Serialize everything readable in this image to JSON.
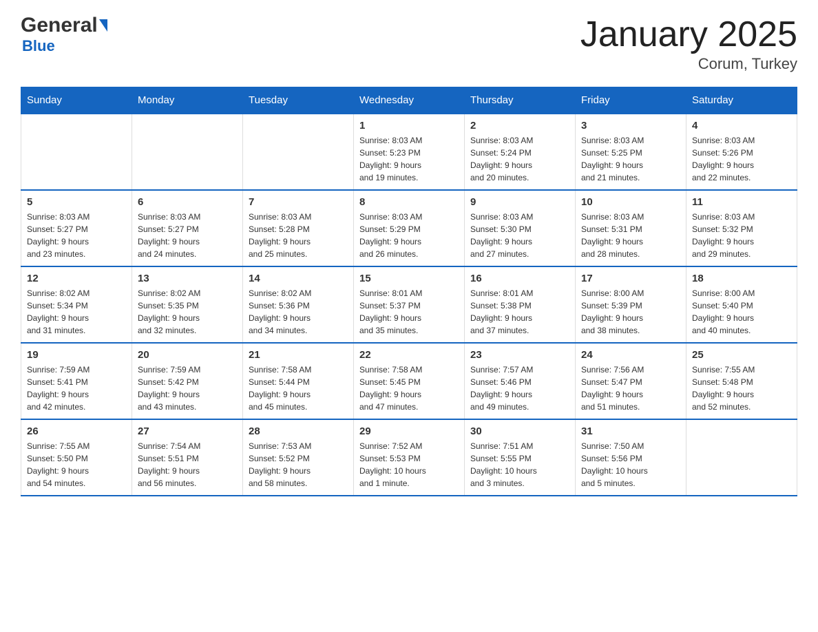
{
  "header": {
    "logo_general": "General",
    "logo_blue": "Blue",
    "title": "January 2025",
    "subtitle": "Corum, Turkey"
  },
  "days_of_week": [
    "Sunday",
    "Monday",
    "Tuesday",
    "Wednesday",
    "Thursday",
    "Friday",
    "Saturday"
  ],
  "weeks": [
    [
      {
        "day": "",
        "info": ""
      },
      {
        "day": "",
        "info": ""
      },
      {
        "day": "",
        "info": ""
      },
      {
        "day": "1",
        "info": "Sunrise: 8:03 AM\nSunset: 5:23 PM\nDaylight: 9 hours\nand 19 minutes."
      },
      {
        "day": "2",
        "info": "Sunrise: 8:03 AM\nSunset: 5:24 PM\nDaylight: 9 hours\nand 20 minutes."
      },
      {
        "day": "3",
        "info": "Sunrise: 8:03 AM\nSunset: 5:25 PM\nDaylight: 9 hours\nand 21 minutes."
      },
      {
        "day": "4",
        "info": "Sunrise: 8:03 AM\nSunset: 5:26 PM\nDaylight: 9 hours\nand 22 minutes."
      }
    ],
    [
      {
        "day": "5",
        "info": "Sunrise: 8:03 AM\nSunset: 5:27 PM\nDaylight: 9 hours\nand 23 minutes."
      },
      {
        "day": "6",
        "info": "Sunrise: 8:03 AM\nSunset: 5:27 PM\nDaylight: 9 hours\nand 24 minutes."
      },
      {
        "day": "7",
        "info": "Sunrise: 8:03 AM\nSunset: 5:28 PM\nDaylight: 9 hours\nand 25 minutes."
      },
      {
        "day": "8",
        "info": "Sunrise: 8:03 AM\nSunset: 5:29 PM\nDaylight: 9 hours\nand 26 minutes."
      },
      {
        "day": "9",
        "info": "Sunrise: 8:03 AM\nSunset: 5:30 PM\nDaylight: 9 hours\nand 27 minutes."
      },
      {
        "day": "10",
        "info": "Sunrise: 8:03 AM\nSunset: 5:31 PM\nDaylight: 9 hours\nand 28 minutes."
      },
      {
        "day": "11",
        "info": "Sunrise: 8:03 AM\nSunset: 5:32 PM\nDaylight: 9 hours\nand 29 minutes."
      }
    ],
    [
      {
        "day": "12",
        "info": "Sunrise: 8:02 AM\nSunset: 5:34 PM\nDaylight: 9 hours\nand 31 minutes."
      },
      {
        "day": "13",
        "info": "Sunrise: 8:02 AM\nSunset: 5:35 PM\nDaylight: 9 hours\nand 32 minutes."
      },
      {
        "day": "14",
        "info": "Sunrise: 8:02 AM\nSunset: 5:36 PM\nDaylight: 9 hours\nand 34 minutes."
      },
      {
        "day": "15",
        "info": "Sunrise: 8:01 AM\nSunset: 5:37 PM\nDaylight: 9 hours\nand 35 minutes."
      },
      {
        "day": "16",
        "info": "Sunrise: 8:01 AM\nSunset: 5:38 PM\nDaylight: 9 hours\nand 37 minutes."
      },
      {
        "day": "17",
        "info": "Sunrise: 8:00 AM\nSunset: 5:39 PM\nDaylight: 9 hours\nand 38 minutes."
      },
      {
        "day": "18",
        "info": "Sunrise: 8:00 AM\nSunset: 5:40 PM\nDaylight: 9 hours\nand 40 minutes."
      }
    ],
    [
      {
        "day": "19",
        "info": "Sunrise: 7:59 AM\nSunset: 5:41 PM\nDaylight: 9 hours\nand 42 minutes."
      },
      {
        "day": "20",
        "info": "Sunrise: 7:59 AM\nSunset: 5:42 PM\nDaylight: 9 hours\nand 43 minutes."
      },
      {
        "day": "21",
        "info": "Sunrise: 7:58 AM\nSunset: 5:44 PM\nDaylight: 9 hours\nand 45 minutes."
      },
      {
        "day": "22",
        "info": "Sunrise: 7:58 AM\nSunset: 5:45 PM\nDaylight: 9 hours\nand 47 minutes."
      },
      {
        "day": "23",
        "info": "Sunrise: 7:57 AM\nSunset: 5:46 PM\nDaylight: 9 hours\nand 49 minutes."
      },
      {
        "day": "24",
        "info": "Sunrise: 7:56 AM\nSunset: 5:47 PM\nDaylight: 9 hours\nand 51 minutes."
      },
      {
        "day": "25",
        "info": "Sunrise: 7:55 AM\nSunset: 5:48 PM\nDaylight: 9 hours\nand 52 minutes."
      }
    ],
    [
      {
        "day": "26",
        "info": "Sunrise: 7:55 AM\nSunset: 5:50 PM\nDaylight: 9 hours\nand 54 minutes."
      },
      {
        "day": "27",
        "info": "Sunrise: 7:54 AM\nSunset: 5:51 PM\nDaylight: 9 hours\nand 56 minutes."
      },
      {
        "day": "28",
        "info": "Sunrise: 7:53 AM\nSunset: 5:52 PM\nDaylight: 9 hours\nand 58 minutes."
      },
      {
        "day": "29",
        "info": "Sunrise: 7:52 AM\nSunset: 5:53 PM\nDaylight: 10 hours\nand 1 minute."
      },
      {
        "day": "30",
        "info": "Sunrise: 7:51 AM\nSunset: 5:55 PM\nDaylight: 10 hours\nand 3 minutes."
      },
      {
        "day": "31",
        "info": "Sunrise: 7:50 AM\nSunset: 5:56 PM\nDaylight: 10 hours\nand 5 minutes."
      },
      {
        "day": "",
        "info": ""
      }
    ]
  ]
}
